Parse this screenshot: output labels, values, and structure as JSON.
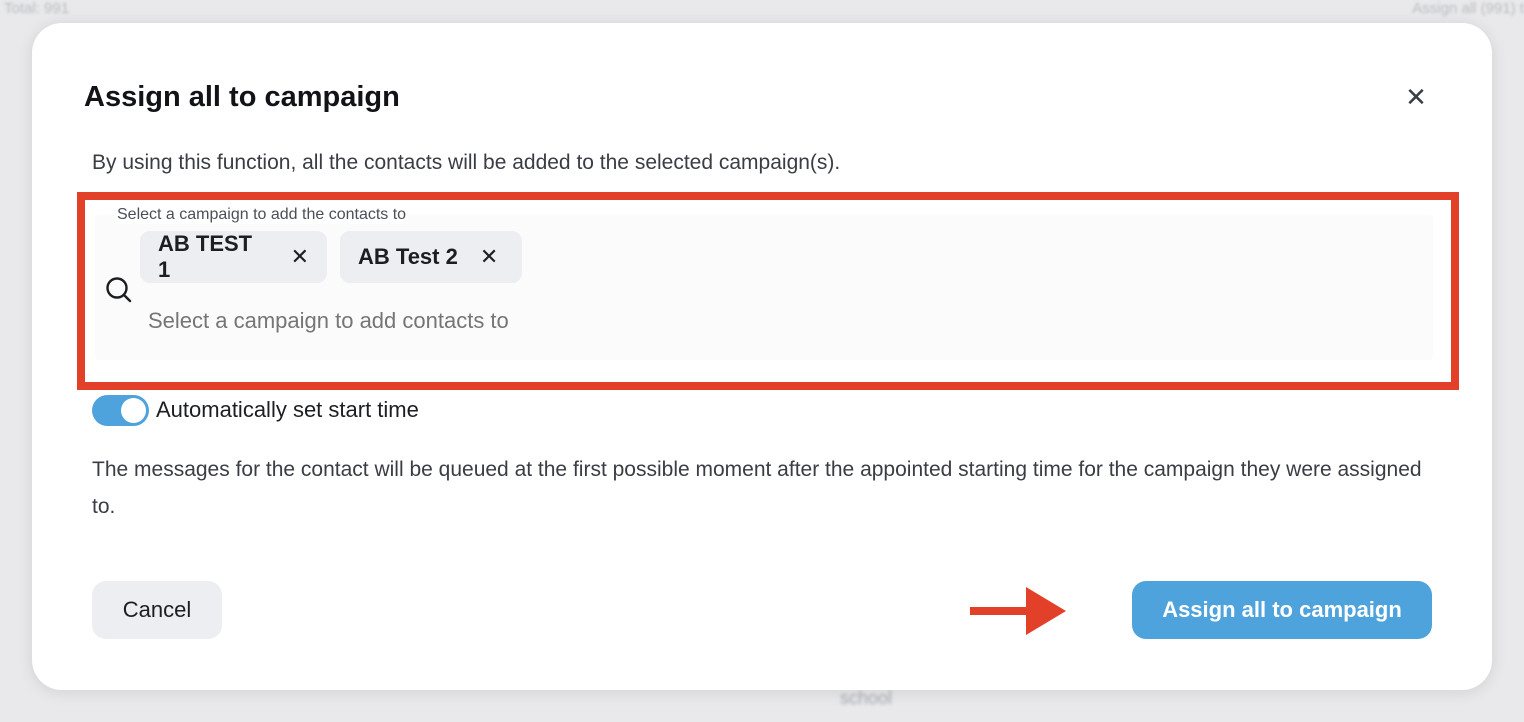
{
  "background": {
    "top_left_text": "Total: 991",
    "top_right_text": "Assign all (991) t",
    "bottom_text": "school"
  },
  "modal": {
    "title": "Assign all to campaign",
    "description": "By using this function, all the contacts will be added to the selected campaign(s).",
    "campaign_select": {
      "label": "Select a campaign to add the contacts to",
      "placeholder": "Select a campaign to add contacts to",
      "selected": [
        {
          "label": "AB TEST 1"
        },
        {
          "label": "AB Test 2"
        }
      ],
      "chip_remove_glyph": "✕"
    },
    "auto_start": {
      "label": "Automatically set start time",
      "enabled": true
    },
    "info_text": "The messages for the contact will be queued at the first possible moment after the appointed starting time for the campaign they were assigned to.",
    "cancel_label": "Cancel",
    "submit_label": "Assign all to campaign",
    "close_glyph": "✕"
  },
  "colors": {
    "accent": "#4fa3dd",
    "highlight": "#e3402a",
    "chip_bg": "#eceef1"
  },
  "icons": {
    "close": "close-icon",
    "search": "search-icon",
    "chip_remove": "close-icon",
    "arrow": "arrow-right-icon"
  }
}
